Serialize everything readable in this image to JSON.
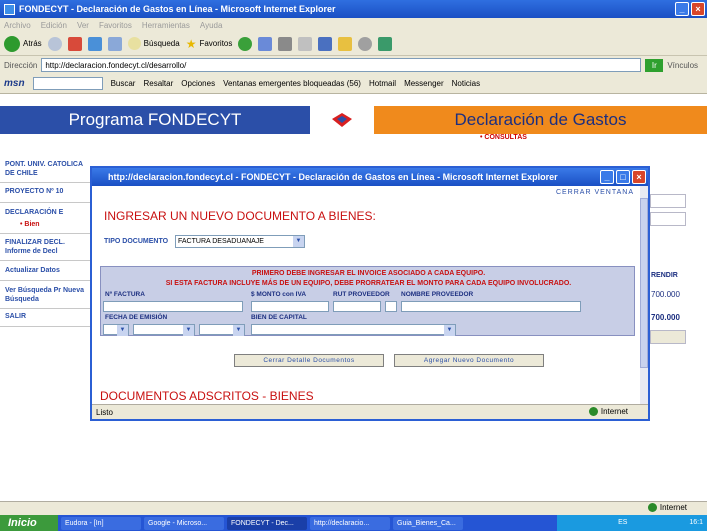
{
  "window": {
    "title": "FONDECYT - Declaración de Gastos en Línea - Microsoft Internet Explorer",
    "menu": [
      "Archivo",
      "Edición",
      "Ver",
      "Favoritos",
      "Herramientas",
      "Ayuda"
    ]
  },
  "toolbar": {
    "back": "Atrás",
    "search": "Búsqueda",
    "favorites": "Favoritos"
  },
  "address": {
    "label": "Dirección",
    "url": "http://declaracion.fondecyt.cl/desarrollo/",
    "go": "Ir",
    "links": "Vínculos"
  },
  "msn": {
    "logo": "msn",
    "buscar": "Buscar",
    "resaltar": "Resaltar",
    "opciones": "Opciones",
    "popups": "Ventanas emergentes bloqueadas (56)",
    "hotmail": "Hotmail",
    "messenger": "Messenger",
    "noticias": "Noticias"
  },
  "page": {
    "banner_left": "Programa FONDECYT",
    "banner_right": "Declaración de Gastos",
    "consultas": "• CONSULTAS",
    "sidebar": [
      "PONT. UNIV. CATOLICA DE CHILE",
      "PROYECTO Nº 10",
      "DECLARACIÓN E",
      "• Bien",
      "FINALIZAR DECL. Informe de Decl",
      "Actualizar Datos",
      "Ver Búsqueda Pr Nueva Búsqueda",
      "SALIR"
    ],
    "right_col": {
      "header": "RENDIR",
      "v1": "700.000",
      "v2": "700.000"
    }
  },
  "popup": {
    "title": "http://declaracion.fondecyt.cl - FONDECYT - Declaración de Gastos en Línea - Microsoft Internet Explorer",
    "cerrar": "CERRAR VENTANA",
    "heading": "INGRESAR UN NUEVO DOCUMENTO A BIENES:",
    "tipo_label": "TIPO DOCUMENTO",
    "tipo_value": "FACTURA DESADUANAJE",
    "warn1": "PRIMERO DEBE INGRESAR EL INVOICE ASOCIADO A CADA EQUIPO.",
    "warn2": "SI ESTA FACTURA INCLUYE MÁS DE UN EQUIPO, DEBE PRORRATEAR EL MONTO PARA CADA EQUIPO INVOLUCRADO.",
    "fields": {
      "n_factura": "Nº FACTURA",
      "monto": "$ MONTO con IVA",
      "rut": "RUT PROVEEDOR",
      "nombre": "NOMBRE PROVEEDOR",
      "fecha": "FECHA DE EMISIÓN",
      "bien": "BIEN DE CAPITAL"
    },
    "btn_cerrar": "Cerrar Detalle Documentos",
    "btn_agregar": "Agregar Nuevo Documento",
    "heading2": "DOCUMENTOS ADSCRITOS - BIENES",
    "status": "Listo",
    "zone": "Internet"
  },
  "outer_status": {
    "zone": "Internet"
  },
  "taskbar": {
    "start": "Inicio",
    "tasks": [
      "Eudora - [In]",
      "Google - Microso...",
      "FONDECYT - Dec...",
      "http://declaracio...",
      "Guia_Bienes_Ca..."
    ],
    "lang": "ES",
    "time": "16:1"
  }
}
